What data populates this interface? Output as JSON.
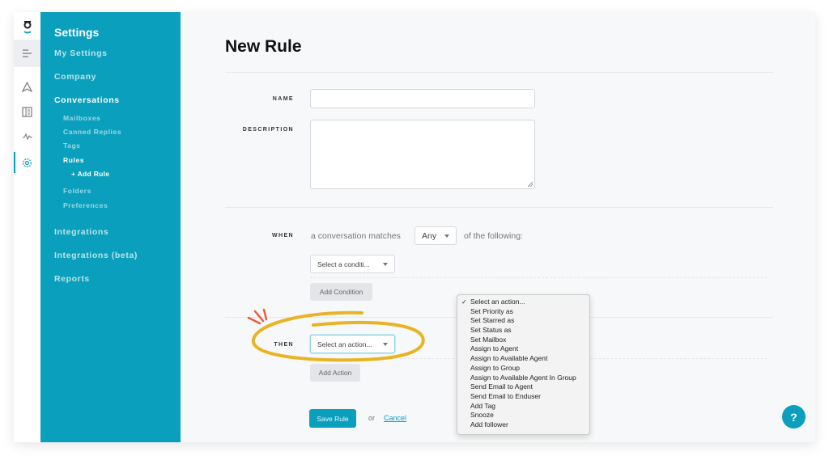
{
  "rail": {
    "icons": [
      "logo-icon",
      "menu-icon",
      "send-icon",
      "book-icon",
      "activity-icon",
      "gear-icon"
    ]
  },
  "sidebar": {
    "title": "Settings",
    "items": [
      {
        "label": "My Settings"
      },
      {
        "label": "Company"
      },
      {
        "label": "Conversations"
      },
      {
        "label": "Integrations"
      },
      {
        "label": "Integrations (beta)"
      },
      {
        "label": "Reports"
      }
    ],
    "conversations_sub": [
      {
        "label": "Mailboxes"
      },
      {
        "label": "Canned Replies"
      },
      {
        "label": "Tags"
      },
      {
        "label": "Rules"
      },
      {
        "label": "+ Add Rule"
      },
      {
        "label": "Folders"
      },
      {
        "label": "Preferences"
      }
    ]
  },
  "main": {
    "title": "New Rule",
    "name_label": "NAME",
    "name_value": "",
    "description_label": "DESCRIPTION",
    "description_value": "",
    "when_label": "WHEN",
    "when_prefix": "a conversation matches",
    "match_select": "Any",
    "when_suffix": "of the following:",
    "condition_select": "Select a conditi...",
    "add_condition": "Add Condition",
    "then_label": "THEN",
    "action_select": "Select an action...",
    "add_action": "Add Action",
    "save_rule": "Save Rule",
    "or_text": "or",
    "cancel": "Cancel"
  },
  "action_dropdown": {
    "selected": "Select an action...",
    "options": [
      "Select an action...",
      "Set Priority as",
      "Set Starred as",
      "Set Status as",
      "Set Mailbox",
      "Assign to Agent",
      "Assign to Available Agent",
      "Assign to Group",
      "Assign to Available Agent In Group",
      "Send Email to Agent",
      "Send Email to Enduser",
      "Add Tag",
      "Snooze",
      "Add follower"
    ]
  },
  "help": {
    "label": "?"
  },
  "colors": {
    "brand": "#0a9fbd",
    "highlight": "#e8b425",
    "accent_marks": "#ea5c3a"
  }
}
